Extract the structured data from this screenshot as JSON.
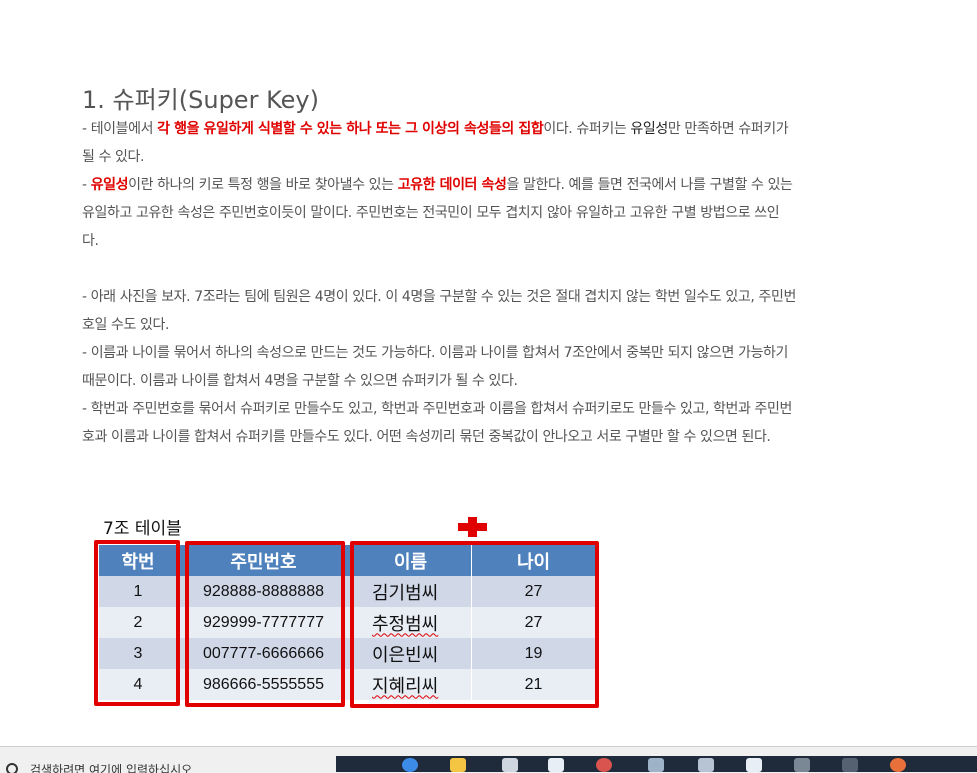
{
  "heading": "1. 슈퍼키(Super Key)",
  "paragraphs": {
    "p1a_pre": "- 테이블에서 ",
    "p1a_red": "각 행을 유일하게 식별할 수 있는 하나 또는 그 이상의 속성들의 집합",
    "p1a_mid": "이다. 슈퍼키는 ",
    "p1a_blk": "유일성",
    "p1a_post": "만 만족하면 슈퍼키가",
    "p1b": "될 수 있다.",
    "p2a_pre": "- ",
    "p2a_red1": "유일성",
    "p2a_mid": "이란 하나의 키로 특정 행을 바로 찾아낼수 있는 ",
    "p2a_red2": "고유한 데이터 속성",
    "p2a_post": "을 말한다. 예를 들면 전국에서 나를 구별할 수 있는",
    "p2b": "유일하고 고유한 속성은 주민번호이듯이 말이다. 주민번호는 전국민이 모두 겹치지 않아 유일하고 고유한 구별 방법으로 쓰인",
    "p2c": "다.",
    "p3a": "- 아래 사진을 보자. 7조라는 팀에 팀원은 4명이 있다. 이 4명을 구분할 수 있는 것은 절대 겹치지 않는 학번 일수도 있고, 주민번",
    "p3b": "호일 수도 있다.",
    "p4a": "- 이름과 나이를 묶어서 하나의 속성으로 만드는 것도 가능하다. 이름과 나이를 합쳐서 7조안에서 중복만 되지 않으면 가능하기",
    "p4b": "때문이다. 이름과 나이를 합쳐서 4명을 구분할 수 있으면 슈퍼키가 될 수 있다.",
    "p5a": "- 학번과 주민번호를 묶어서 슈퍼키로 만들수도 있고, 학번과 주민번호과 이름을 합쳐서 슈퍼키로도 만들수 있고, 학번과 주민번",
    "p5b": "호과 이름과 나이를 합쳐서 슈퍼키를 만들수도 있다. 어떤 속성끼리 묶던 중복값이 안나오고 서로 구별만 할 수 있으면 된다."
  },
  "table": {
    "caption": "7조 테이블",
    "headers": [
      "학번",
      "주민번호",
      "이름",
      "나이"
    ],
    "rows": [
      [
        "1",
        "928888-8888888",
        "김기범씨",
        "27"
      ],
      [
        "2",
        "929999-7777777",
        "추정범씨",
        "27"
      ],
      [
        "3",
        "007777-6666666",
        "이은빈씨",
        "19"
      ],
      [
        "4",
        "986666-5555555",
        "지혜리씨",
        "21"
      ]
    ]
  },
  "status": {
    "search_text": "검색하려면 여기에 입력하십시오"
  },
  "colors": {
    "header_bg": "#4f81bd",
    "row_odd": "#d0d8e8",
    "row_even": "#e9edf4",
    "highlight": "#e00000",
    "body_text": "#555555"
  }
}
